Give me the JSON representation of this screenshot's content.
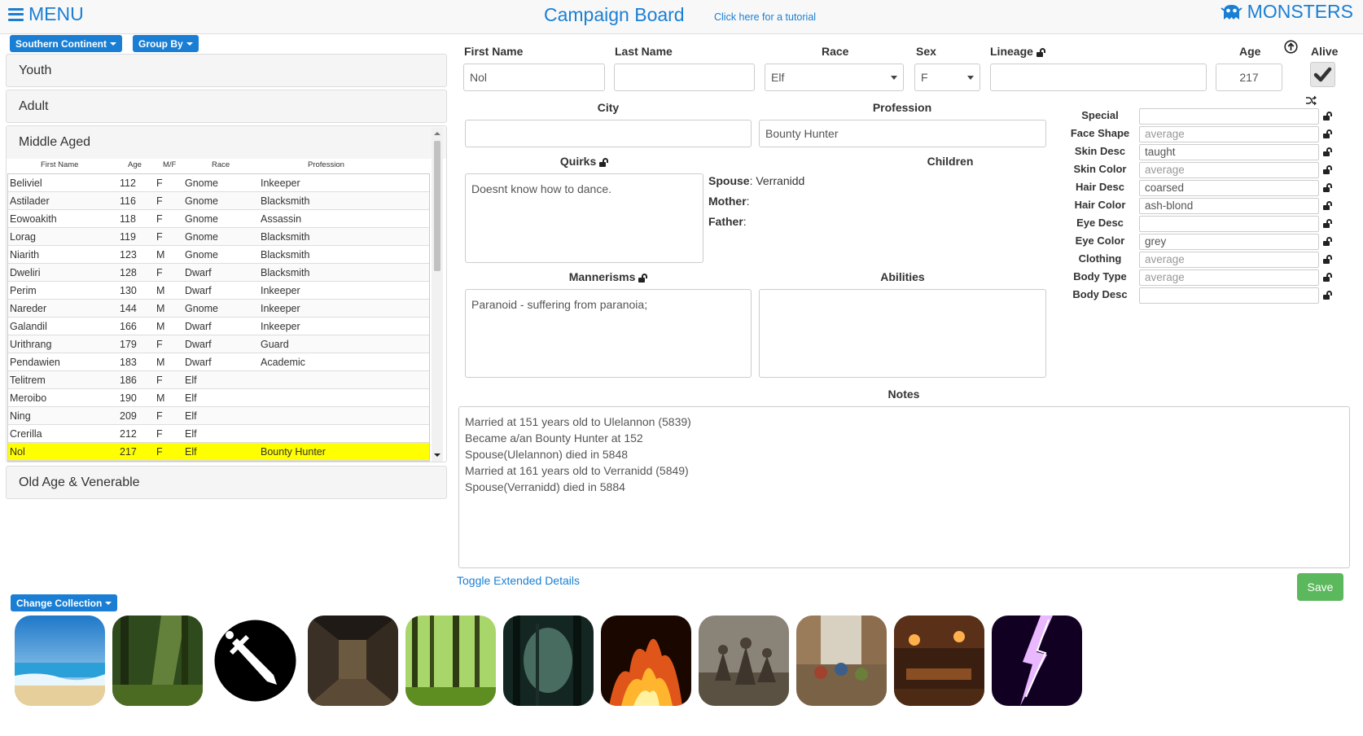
{
  "header": {
    "menu_label": "MENU",
    "title": "Campaign Board",
    "tutorial_link": "Click here for a tutorial",
    "monsters_label": "MONSTERS"
  },
  "filters": {
    "region": "Southern Continent",
    "group_by": "Group By"
  },
  "groups": {
    "youth": "Youth",
    "adult": "Adult",
    "middle_aged": "Middle Aged",
    "old_age": "Old Age & Venerable"
  },
  "table": {
    "headers": [
      "First Name",
      "Age",
      "M/F",
      "Race",
      "Profession"
    ],
    "rows": [
      {
        "name": "Beliviel",
        "age": "112",
        "sex": "F",
        "race": "Gnome",
        "profession": "Inkeeper"
      },
      {
        "name": "Astilader",
        "age": "116",
        "sex": "F",
        "race": "Gnome",
        "profession": "Blacksmith"
      },
      {
        "name": "Eowoakith",
        "age": "118",
        "sex": "F",
        "race": "Gnome",
        "profession": "Assassin"
      },
      {
        "name": "Lorag",
        "age": "119",
        "sex": "F",
        "race": "Gnome",
        "profession": "Blacksmith"
      },
      {
        "name": "Niarith",
        "age": "123",
        "sex": "M",
        "race": "Gnome",
        "profession": "Blacksmith"
      },
      {
        "name": "Dweliri",
        "age": "128",
        "sex": "F",
        "race": "Dwarf",
        "profession": "Blacksmith"
      },
      {
        "name": "Perim",
        "age": "130",
        "sex": "M",
        "race": "Dwarf",
        "profession": "Inkeeper"
      },
      {
        "name": "Nareder",
        "age": "144",
        "sex": "M",
        "race": "Gnome",
        "profession": "Inkeeper"
      },
      {
        "name": "Galandil",
        "age": "166",
        "sex": "M",
        "race": "Dwarf",
        "profession": "Inkeeper"
      },
      {
        "name": "Urithrang",
        "age": "179",
        "sex": "F",
        "race": "Dwarf",
        "profession": "Guard"
      },
      {
        "name": "Pendawien",
        "age": "183",
        "sex": "M",
        "race": "Dwarf",
        "profession": "Academic"
      },
      {
        "name": "Telitrem",
        "age": "186",
        "sex": "F",
        "race": "Elf",
        "profession": ""
      },
      {
        "name": "Meroibo",
        "age": "190",
        "sex": "M",
        "race": "Elf",
        "profession": ""
      },
      {
        "name": "Ning",
        "age": "209",
        "sex": "F",
        "race": "Elf",
        "profession": ""
      },
      {
        "name": "Crerilla",
        "age": "212",
        "sex": "F",
        "race": "Elf",
        "profession": ""
      },
      {
        "name": "Nol",
        "age": "217",
        "sex": "F",
        "race": "Elf",
        "profession": "Bounty Hunter",
        "selected": true
      }
    ]
  },
  "form": {
    "labels": {
      "first_name": "First Name",
      "last_name": "Last Name",
      "race": "Race",
      "sex": "Sex",
      "lineage": "Lineage",
      "age": "Age",
      "alive": "Alive",
      "city": "City",
      "profession": "Profession",
      "quirks": "Quirks",
      "children": "Children",
      "mannerisms": "Mannerisms",
      "abilities": "Abilities",
      "notes": "Notes"
    },
    "first_name": "Nol",
    "last_name": "",
    "race": "Elf",
    "sex": "F",
    "lineage": "",
    "age": "217",
    "alive": true,
    "city": "",
    "profession": "Bounty Hunter",
    "quirks": "Doesnt know how to dance.",
    "mannerisms": "Paranoid - suffering from paranoia;",
    "abilities": "",
    "family": {
      "spouse_label": "Spouse",
      "spouse": "Verranidd",
      "mother_label": "Mother",
      "mother": "",
      "father_label": "Father",
      "father": ""
    },
    "notes": [
      "Married at 151 years old to Ulelannon (5839)",
      "Became a/an Bounty Hunter at 152",
      "Spouse(Ulelannon) died in 5848",
      "Married at 161 years old to Verranidd (5849)",
      "Spouse(Verranidd) died in 5884"
    ]
  },
  "traits": [
    {
      "label": "Special",
      "value": "",
      "placeholder": false
    },
    {
      "label": "Face Shape",
      "value": "average",
      "placeholder": true
    },
    {
      "label": "Skin Desc",
      "value": "taught",
      "placeholder": false
    },
    {
      "label": "Skin Color",
      "value": "average",
      "placeholder": true
    },
    {
      "label": "Hair Desc",
      "value": "coarsed",
      "placeholder": false
    },
    {
      "label": "Hair Color",
      "value": "ash-blond",
      "placeholder": false
    },
    {
      "label": "Eye Desc",
      "value": "",
      "placeholder": false
    },
    {
      "label": "Eye Color",
      "value": "grey",
      "placeholder": false
    },
    {
      "label": "Clothing",
      "value": "average",
      "placeholder": true
    },
    {
      "label": "Body Type",
      "value": "average",
      "placeholder": true
    },
    {
      "label": "Body Desc",
      "value": "",
      "placeholder": false
    }
  ],
  "footer": {
    "toggle_link": "Toggle Extended Details",
    "save_label": "Save",
    "collection_label": "Change Collection"
  },
  "scenes": [
    "beach",
    "forest-glade",
    "sword",
    "dungeon",
    "green-forest",
    "dark-forest",
    "fire",
    "battle",
    "market",
    "tavern",
    "lightning"
  ],
  "colors": {
    "accent": "#1a7fd4",
    "selected_row": "#ffff00",
    "save": "#5cb85c"
  }
}
